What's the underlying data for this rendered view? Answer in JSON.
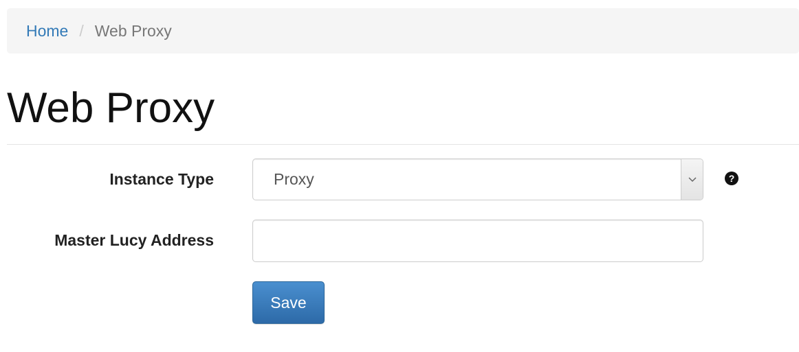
{
  "breadcrumb": {
    "items": [
      {
        "label": "Home",
        "link": true
      },
      {
        "label": "Web Proxy",
        "link": false
      }
    ],
    "separator": "/"
  },
  "page": {
    "title": "Web Proxy"
  },
  "form": {
    "instance_type": {
      "label": "Instance Type",
      "selected": "Proxy",
      "help_icon": "question-circle-icon"
    },
    "master_address": {
      "label": "Master Lucy Address",
      "value": "",
      "placeholder": ""
    },
    "save_label": "Save"
  },
  "colors": {
    "link": "#337ab7",
    "breadcrumb_bg": "#f5f5f5",
    "primary_button": "#337ab7"
  }
}
